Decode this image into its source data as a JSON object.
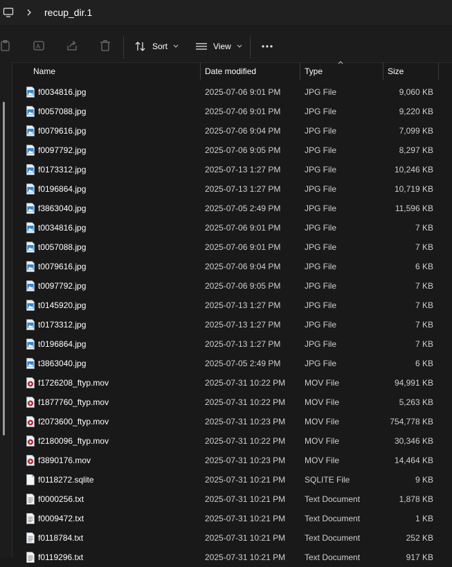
{
  "address": {
    "path": "recup_dir.1"
  },
  "toolbar": {
    "sort_label": "Sort",
    "view_label": "View"
  },
  "columns": {
    "name": "Name",
    "date": "Date modified",
    "type": "Type",
    "size": "Size"
  },
  "files": [
    {
      "name": "f0034816.jpg",
      "date": "2025-07-06 9:01 PM",
      "type": "JPG File",
      "size": "9,060 KB",
      "icon": "jpg-file-icon"
    },
    {
      "name": "f0057088.jpg",
      "date": "2025-07-06 9:01 PM",
      "type": "JPG File",
      "size": "9,220 KB",
      "icon": "jpg-file-icon"
    },
    {
      "name": "f0079616.jpg",
      "date": "2025-07-06 9:04 PM",
      "type": "JPG File",
      "size": "7,099 KB",
      "icon": "jpg-file-icon"
    },
    {
      "name": "f0097792.jpg",
      "date": "2025-07-06 9:05 PM",
      "type": "JPG File",
      "size": "8,297 KB",
      "icon": "jpg-file-icon"
    },
    {
      "name": "f0173312.jpg",
      "date": "2025-07-13 1:27 PM",
      "type": "JPG File",
      "size": "10,246 KB",
      "icon": "jpg-file-icon"
    },
    {
      "name": "f0196864.jpg",
      "date": "2025-07-13 1:27 PM",
      "type": "JPG File",
      "size": "10,719 KB",
      "icon": "jpg-file-icon"
    },
    {
      "name": "f3863040.jpg",
      "date": "2025-07-05 2:49 PM",
      "type": "JPG File",
      "size": "11,596 KB",
      "icon": "jpg-file-icon"
    },
    {
      "name": "t0034816.jpg",
      "date": "2025-07-06 9:01 PM",
      "type": "JPG File",
      "size": "7 KB",
      "icon": "jpg-file-icon"
    },
    {
      "name": "t0057088.jpg",
      "date": "2025-07-06 9:01 PM",
      "type": "JPG File",
      "size": "7 KB",
      "icon": "jpg-file-icon"
    },
    {
      "name": "t0079616.jpg",
      "date": "2025-07-06 9:04 PM",
      "type": "JPG File",
      "size": "6 KB",
      "icon": "jpg-file-icon"
    },
    {
      "name": "t0097792.jpg",
      "date": "2025-07-06 9:05 PM",
      "type": "JPG File",
      "size": "7 KB",
      "icon": "jpg-file-icon"
    },
    {
      "name": "t0145920.jpg",
      "date": "2025-07-13 1:27 PM",
      "type": "JPG File",
      "size": "7 KB",
      "icon": "jpg-file-icon"
    },
    {
      "name": "t0173312.jpg",
      "date": "2025-07-13 1:27 PM",
      "type": "JPG File",
      "size": "7 KB",
      "icon": "jpg-file-icon"
    },
    {
      "name": "t0196864.jpg",
      "date": "2025-07-13 1:27 PM",
      "type": "JPG File",
      "size": "7 KB",
      "icon": "jpg-file-icon"
    },
    {
      "name": "t3863040.jpg",
      "date": "2025-07-05 2:49 PM",
      "type": "JPG File",
      "size": "6 KB",
      "icon": "jpg-file-icon"
    },
    {
      "name": "f1726208_ftyp.mov",
      "date": "2025-07-31 10:22 PM",
      "type": "MOV File",
      "size": "94,991 KB",
      "icon": "mov-file-icon"
    },
    {
      "name": "f1877760_ftyp.mov",
      "date": "2025-07-31 10:22 PM",
      "type": "MOV File",
      "size": "5,263 KB",
      "icon": "mov-file-icon"
    },
    {
      "name": "f2073600_ftyp.mov",
      "date": "2025-07-31 10:23 PM",
      "type": "MOV File",
      "size": "754,778 KB",
      "icon": "mov-file-icon"
    },
    {
      "name": "f2180096_ftyp.mov",
      "date": "2025-07-31 10:22 PM",
      "type": "MOV File",
      "size": "30,346 KB",
      "icon": "mov-file-icon"
    },
    {
      "name": "f3890176.mov",
      "date": "2025-07-31 10:23 PM",
      "type": "MOV File",
      "size": "14,464 KB",
      "icon": "mov-file-icon"
    },
    {
      "name": "f0118272.sqlite",
      "date": "2025-07-31 10:21 PM",
      "type": "SQLITE File",
      "size": "9 KB",
      "icon": "blank-file-icon"
    },
    {
      "name": "f0000256.txt",
      "date": "2025-07-31 10:21 PM",
      "type": "Text Document",
      "size": "1,878 KB",
      "icon": "text-file-icon"
    },
    {
      "name": "f0009472.txt",
      "date": "2025-07-31 10:21 PM",
      "type": "Text Document",
      "size": "1 KB",
      "icon": "text-file-icon"
    },
    {
      "name": "f0118784.txt",
      "date": "2025-07-31 10:21 PM",
      "type": "Text Document",
      "size": "252 KB",
      "icon": "text-file-icon"
    },
    {
      "name": "f0119296.txt",
      "date": "2025-07-31 10:21 PM",
      "type": "Text Document",
      "size": "917 KB",
      "icon": "text-file-icon"
    }
  ]
}
